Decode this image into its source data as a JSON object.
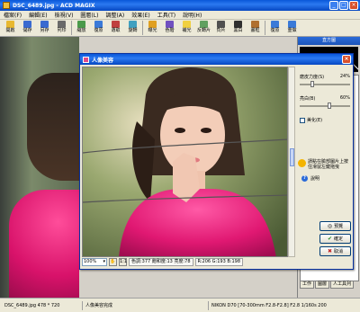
{
  "window": {
    "title": "DSC_6489.jpg - ACD MAGIX",
    "buttons": [
      "_",
      "□",
      "×"
    ]
  },
  "menu": [
    "檔案(F)",
    "編輯(E)",
    "檢視(V)",
    "圖層(L)",
    "調整(A)",
    "效果(E)",
    "工具(T)",
    "說明(H)"
  ],
  "toolbar": [
    {
      "label": "開啟",
      "color": "#e8b830"
    },
    {
      "label": "儲存",
      "color": "#3a6ad0"
    },
    {
      "label": "另存",
      "color": "#3a6ad0"
    },
    {
      "label": "列印",
      "color": "#6a6a6a"
    },
    {
      "label": "縮放",
      "color": "#4a9a4a"
    },
    {
      "label": "復原",
      "color": "#3a7ad8"
    },
    {
      "label": "選取",
      "color": "#c04040"
    },
    {
      "label": "旋轉",
      "color": "#40a0c0"
    },
    {
      "label": "曝光",
      "color": "#e0a020"
    },
    {
      "label": "色階",
      "color": "#7050c0"
    },
    {
      "label": "補光",
      "color": "#f0d040"
    },
    {
      "label": "反轉片",
      "color": "#60a060"
    },
    {
      "label": "負片",
      "color": "#505050"
    },
    {
      "label": "黑白",
      "color": "#303030"
    },
    {
      "label": "畫框",
      "color": "#b07030"
    },
    {
      "label": "復原",
      "color": "#3a7ad8"
    },
    {
      "label": "重做",
      "color": "#3a7ad8"
    }
  ],
  "right_panel": {
    "header": "直方圖",
    "tabs": [
      "工作",
      "圖層",
      "人工具列"
    ]
  },
  "dialog": {
    "title": "人像美容",
    "close": "×",
    "zoom": "100%",
    "zoom_btn": "1:1",
    "info_color": "色調:377 飽和度:13 亮度:78",
    "info_rgb": "R:206 G:193 B:198",
    "smoothing_label": "磨皮力度(S)",
    "smoothing_value": "24%",
    "smoothing_level": 0.24,
    "brightness_label": "亮白(B)",
    "brightness_value": "60%",
    "brightness_level": 0.6,
    "checkbox_label": "美化(E)",
    "hint_text": "請點在臉部圖片上按住滑鼠左鍵拖曳",
    "help_label": "說明",
    "reset_label": "預覽",
    "ok_label": "確定",
    "cancel_label": "取消"
  },
  "status": {
    "file": "DSC_6489.jpg  478 * 720",
    "message": "人像美容完成",
    "camera": "NIKON D70 [70-300mm F2.8-F2.8] F2.8 1/160s 200"
  }
}
